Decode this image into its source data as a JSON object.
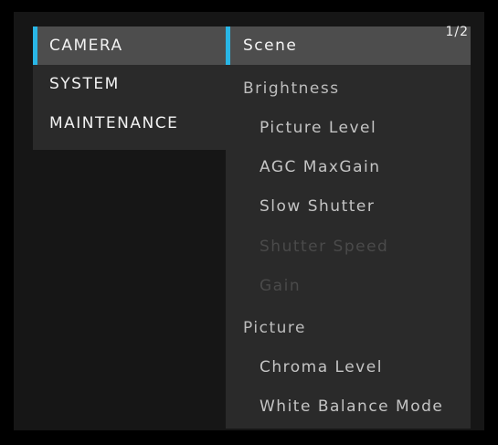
{
  "left_menu": {
    "items": [
      {
        "label": "CAMERA"
      },
      {
        "label": "SYSTEM"
      },
      {
        "label": "MAINTENANCE"
      }
    ]
  },
  "right_menu": {
    "page_indicator": "1/2",
    "items": [
      {
        "label": "Scene",
        "state": "selected"
      },
      {
        "label": "Brightness",
        "state": "group"
      },
      {
        "label": "Picture Level",
        "state": "enabled"
      },
      {
        "label": "AGC MaxGain",
        "state": "enabled"
      },
      {
        "label": "Slow Shutter",
        "state": "enabled"
      },
      {
        "label": "Shutter Speed",
        "state": "disabled"
      },
      {
        "label": "Gain",
        "state": "disabled"
      },
      {
        "label": "Picture",
        "state": "group"
      },
      {
        "label": "Chroma Level",
        "state": "enabled"
      },
      {
        "label": "White Balance Mode",
        "state": "enabled"
      }
    ]
  },
  "colors": {
    "accent": "#29b6e6",
    "panel": "#2a2a2a",
    "highlight": "#4d4d4d",
    "disabled_text": "#4a4a4a"
  }
}
